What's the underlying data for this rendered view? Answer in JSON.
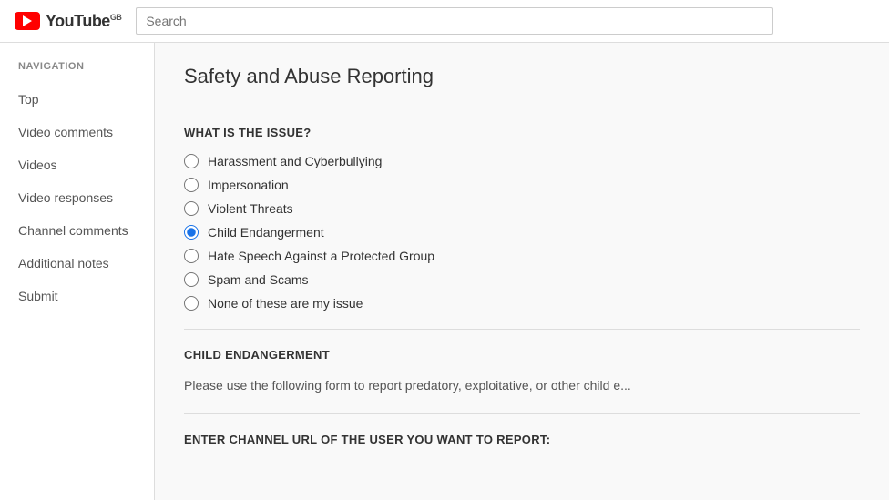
{
  "header": {
    "logo_text": "YouTube",
    "logo_gb": "GB",
    "search_placeholder": "Search"
  },
  "sidebar": {
    "nav_label": "NAVIGATION",
    "items": [
      {
        "label": "Top"
      },
      {
        "label": "Video comments"
      },
      {
        "label": "Videos"
      },
      {
        "label": "Video responses"
      },
      {
        "label": "Channel comments"
      },
      {
        "label": "Additional notes"
      },
      {
        "label": "Submit"
      }
    ]
  },
  "content": {
    "page_title": "Safety and Abuse Reporting",
    "issue_section": {
      "label": "WHAT IS THE ISSUE?",
      "options": [
        {
          "id": "opt1",
          "label": "Harassment and Cyberbullying",
          "checked": false
        },
        {
          "id": "opt2",
          "label": "Impersonation",
          "checked": false
        },
        {
          "id": "opt3",
          "label": "Violent Threats",
          "checked": false
        },
        {
          "id": "opt4",
          "label": "Child Endangerment",
          "checked": true
        },
        {
          "id": "opt5",
          "label": "Hate Speech Against a Protected Group",
          "checked": false
        },
        {
          "id": "opt6",
          "label": "Spam and Scams",
          "checked": false
        },
        {
          "id": "opt7",
          "label": "None of these are my issue",
          "checked": false
        }
      ]
    },
    "child_section": {
      "title": "CHILD ENDANGERMENT",
      "description": "Please use the following form to report predatory, exploitative, or other child e..."
    },
    "channel_url_label": "ENTER CHANNEL URL OF THE USER YOU WANT TO REPORT:"
  }
}
